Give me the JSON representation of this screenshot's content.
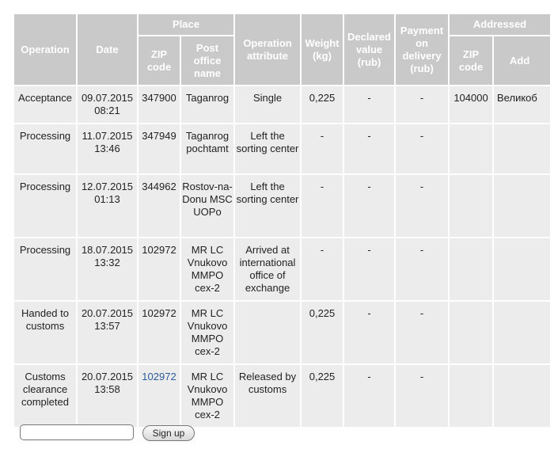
{
  "headers": {
    "operation": "Operation",
    "date": "Date",
    "place": "Place",
    "zip": "ZIP code",
    "post_office": "Post office name",
    "attribute": "Operation attribute",
    "weight": "Weight (kg)",
    "declared": "Declared value (rub)",
    "payment": "Payment on delivery (rub)",
    "addressed": "Addressed",
    "addr_zip": "ZIP code",
    "addr_partial": "Add"
  },
  "rows": [
    {
      "operation": "Acceptance",
      "date": "09.07.2015 08:21",
      "zip": "347900",
      "office": "Taganrog",
      "attribute": "Single",
      "weight": "0,225",
      "declared": "-",
      "payment": "-",
      "addr_zip": "104000",
      "addr": "Великоб"
    },
    {
      "operation": "Processing",
      "date": "11.07.2015 13:46",
      "zip": "347949",
      "office": "Taganrog pochtamt",
      "attribute": "Left the sorting center",
      "weight": "-",
      "declared": "-",
      "payment": "-",
      "addr_zip": "",
      "addr": ""
    },
    {
      "operation": "Processing",
      "date": "12.07.2015 01:13",
      "zip": "344962",
      "office": "Rostov-na-Donu MSC UOPo",
      "attribute": "Left the sorting center",
      "weight": "-",
      "declared": "-",
      "payment": "-",
      "addr_zip": "",
      "addr": ""
    },
    {
      "operation": "Processing",
      "date": "18.07.2015 13:32",
      "zip": "102972",
      "office": "MR LC Vnukovo MMPO cex-2",
      "attribute": "Arrived at international office of exchange",
      "weight": "-",
      "declared": "-",
      "payment": "-",
      "addr_zip": "",
      "addr": ""
    },
    {
      "operation": "Handed to customs",
      "date": "20.07.2015 13:57",
      "zip": "102972",
      "office": "MR LC Vnukovo MMPO cex-2",
      "attribute": "",
      "weight": "0,225",
      "declared": "-",
      "payment": "-",
      "addr_zip": "",
      "addr": ""
    },
    {
      "operation": "Customs clearance completed",
      "date": "20.07.2015 13:58",
      "zip": "102972",
      "office": "MR LC Vnukovo MMPO cex-2",
      "attribute": "Released by customs",
      "weight": "0,225",
      "declared": "-",
      "payment": "-",
      "addr_zip": "",
      "addr": ""
    }
  ],
  "form": {
    "email_value": "",
    "signup_label": "Sign up"
  }
}
